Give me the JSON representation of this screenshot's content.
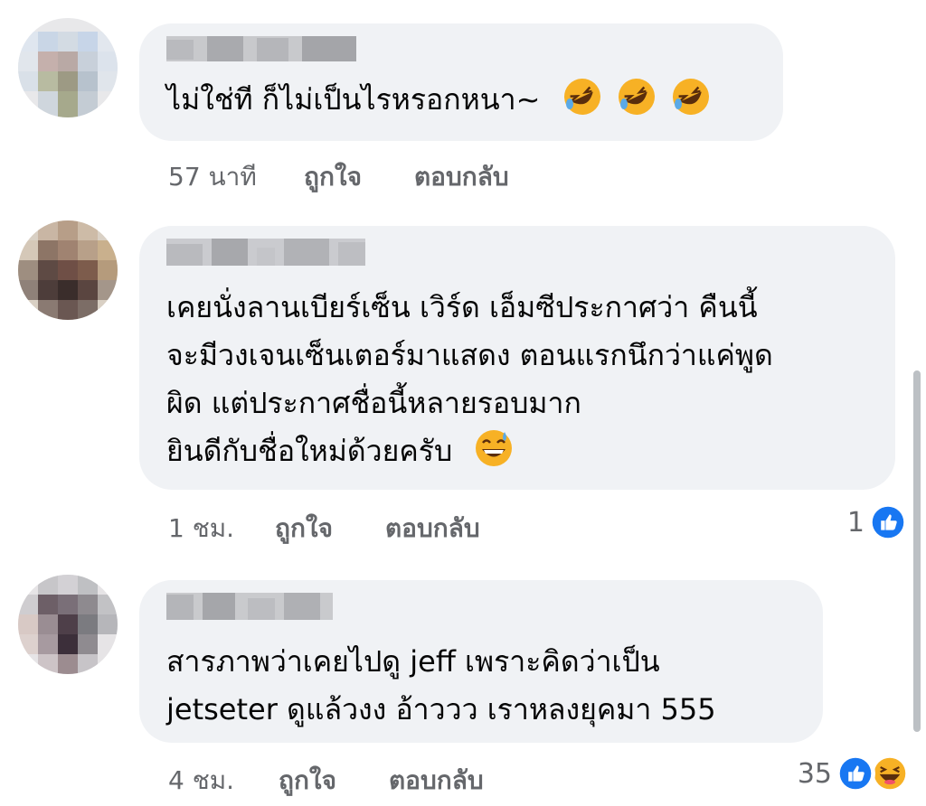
{
  "comments": [
    {
      "text_lines": [
        "ไม่ใช่ที ก็ไม่เป็นไรหรอกหนา~"
      ],
      "emoji_after": [
        "rofl-emoji",
        "rofl-emoji",
        "rofl-emoji"
      ],
      "time": "57 นาที",
      "like_label": "ถูกใจ",
      "reply_label": "ตอบกลับ",
      "reaction_count": ""
    },
    {
      "text_lines": [
        "เคยนั่งลานเบียร์เซ็น เวิร์ด เอ็มซีประกาศว่า คืนนี้",
        "จะมีวงเจนเซ็นเตอร์มาแสดง ตอนแรกนึกว่าแค่พูด",
        "ผิด แต่ประกาศชื่อนี้หลายรอบมาก",
        "ยินดีกับชื่อใหม่ด้วยครับ"
      ],
      "emoji_after": [
        "grinning-sweat-emoji"
      ],
      "time": "1 ชม.",
      "like_label": "ถูกใจ",
      "reply_label": "ตอบกลับ",
      "reaction_count": "1",
      "reaction_icons": [
        "like-icon"
      ]
    },
    {
      "text_lines": [
        "สารภาพว่าเคยไปดู jeff เพราะคิดว่าเป็น",
        "jetseter ดูแล้วงง อ้าววว เราหลงยุคมา 555"
      ],
      "emoji_after": [],
      "time": "4 ชม.",
      "like_label": "ถูกใจ",
      "reply_label": "ตอบกลับ",
      "reaction_count": "35",
      "reaction_icons": [
        "like-icon",
        "haha-icon"
      ]
    }
  ],
  "colors": {
    "bubble": "#f0f2f5",
    "meta_text": "#65676b",
    "like_blue": "#1877f2",
    "haha_yellow": "#f7b125"
  }
}
